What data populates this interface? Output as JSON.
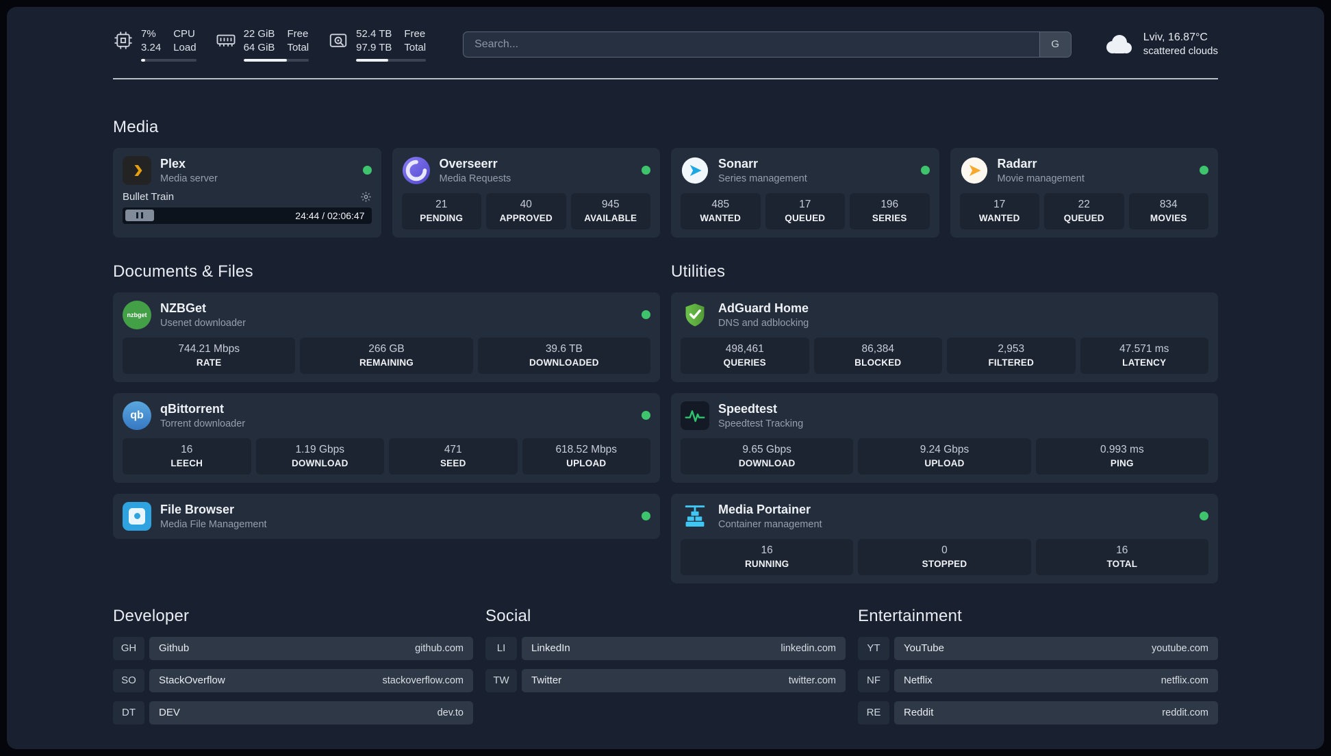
{
  "colors": {
    "status_online": "#3ec46d",
    "plex_accent": "#e5a00d",
    "page_bg": "#19202f",
    "card_bg": "#242d3c"
  },
  "topbar": {
    "cpu": {
      "value": "7%",
      "sub": "3.24",
      "label_top": "CPU",
      "label_bottom": "Load",
      "progress": 7
    },
    "ram": {
      "value": "22 GiB",
      "sub": "64 GiB",
      "label_top": "Free",
      "label_bottom": "Total",
      "progress": 66
    },
    "disk": {
      "value": "52.4 TB",
      "sub": "97.9 TB",
      "label_top": "Free",
      "label_bottom": "Total",
      "progress": 46
    },
    "search": {
      "placeholder": "Search...",
      "button_label": "G"
    },
    "weather": {
      "location": "Lviv, 16.87°C",
      "condition": "scattered clouds"
    }
  },
  "sections": {
    "media": "Media",
    "documents": "Documents & Files",
    "utilities": "Utilities",
    "developer": "Developer",
    "social": "Social",
    "entertainment": "Entertainment"
  },
  "apps": {
    "plex": {
      "name": "Plex",
      "desc": "Media server",
      "now_playing": "Bullet Train",
      "timestamp": "24:44 / 02:06:47"
    },
    "overseerr": {
      "name": "Overseerr",
      "desc": "Media Requests",
      "stats": [
        {
          "value": "21",
          "label": "PENDING"
        },
        {
          "value": "40",
          "label": "APPROVED"
        },
        {
          "value": "945",
          "label": "AVAILABLE"
        }
      ]
    },
    "sonarr": {
      "name": "Sonarr",
      "desc": "Series management",
      "stats": [
        {
          "value": "485",
          "label": "WANTED"
        },
        {
          "value": "17",
          "label": "QUEUED"
        },
        {
          "value": "196",
          "label": "SERIES"
        }
      ]
    },
    "radarr": {
      "name": "Radarr",
      "desc": "Movie management",
      "stats": [
        {
          "value": "17",
          "label": "WANTED"
        },
        {
          "value": "22",
          "label": "QUEUED"
        },
        {
          "value": "834",
          "label": "MOVIES"
        }
      ]
    },
    "nzbget": {
      "name": "NZBGet",
      "desc": "Usenet downloader",
      "icon_text": "nzbget",
      "stats": [
        {
          "value": "744.21 Mbps",
          "label": "RATE"
        },
        {
          "value": "266 GB",
          "label": "REMAINING"
        },
        {
          "value": "39.6 TB",
          "label": "DOWNLOADED"
        }
      ]
    },
    "qbittorrent": {
      "name": "qBittorrent",
      "desc": "Torrent downloader",
      "icon_text": "qb",
      "stats": [
        {
          "value": "16",
          "label": "LEECH"
        },
        {
          "value": "1.19 Gbps",
          "label": "DOWNLOAD"
        },
        {
          "value": "471",
          "label": "SEED"
        },
        {
          "value": "618.52 Mbps",
          "label": "UPLOAD"
        }
      ]
    },
    "filebrowser": {
      "name": "File Browser",
      "desc": "Media File Management"
    },
    "adguard": {
      "name": "AdGuard Home",
      "desc": "DNS and adblocking",
      "stats": [
        {
          "value": "498,461",
          "label": "QUERIES"
        },
        {
          "value": "86,384",
          "label": "BLOCKED"
        },
        {
          "value": "2,953",
          "label": "FILTERED"
        },
        {
          "value": "47.571 ms",
          "label": "LATENCY"
        }
      ]
    },
    "speedtest": {
      "name": "Speedtest",
      "desc": "Speedtest Tracking",
      "stats": [
        {
          "value": "9.65 Gbps",
          "label": "DOWNLOAD"
        },
        {
          "value": "9.24 Gbps",
          "label": "UPLOAD"
        },
        {
          "value": "0.993 ms",
          "label": "PING"
        }
      ]
    },
    "portainer": {
      "name": "Media Portainer",
      "desc": "Container management",
      "stats": [
        {
          "value": "16",
          "label": "RUNNING"
        },
        {
          "value": "0",
          "label": "STOPPED"
        },
        {
          "value": "16",
          "label": "TOTAL"
        }
      ]
    }
  },
  "bookmarks": {
    "developer": [
      {
        "abbr": "GH",
        "name": "Github",
        "url": "github.com"
      },
      {
        "abbr": "SO",
        "name": "StackOverflow",
        "url": "stackoverflow.com"
      },
      {
        "abbr": "DT",
        "name": "DEV",
        "url": "dev.to"
      }
    ],
    "social": [
      {
        "abbr": "LI",
        "name": "LinkedIn",
        "url": "linkedin.com"
      },
      {
        "abbr": "TW",
        "name": "Twitter",
        "url": "twitter.com"
      }
    ],
    "entertainment": [
      {
        "abbr": "YT",
        "name": "YouTube",
        "url": "youtube.com"
      },
      {
        "abbr": "NF",
        "name": "Netflix",
        "url": "netflix.com"
      },
      {
        "abbr": "RE",
        "name": "Reddit",
        "url": "reddit.com"
      }
    ]
  }
}
